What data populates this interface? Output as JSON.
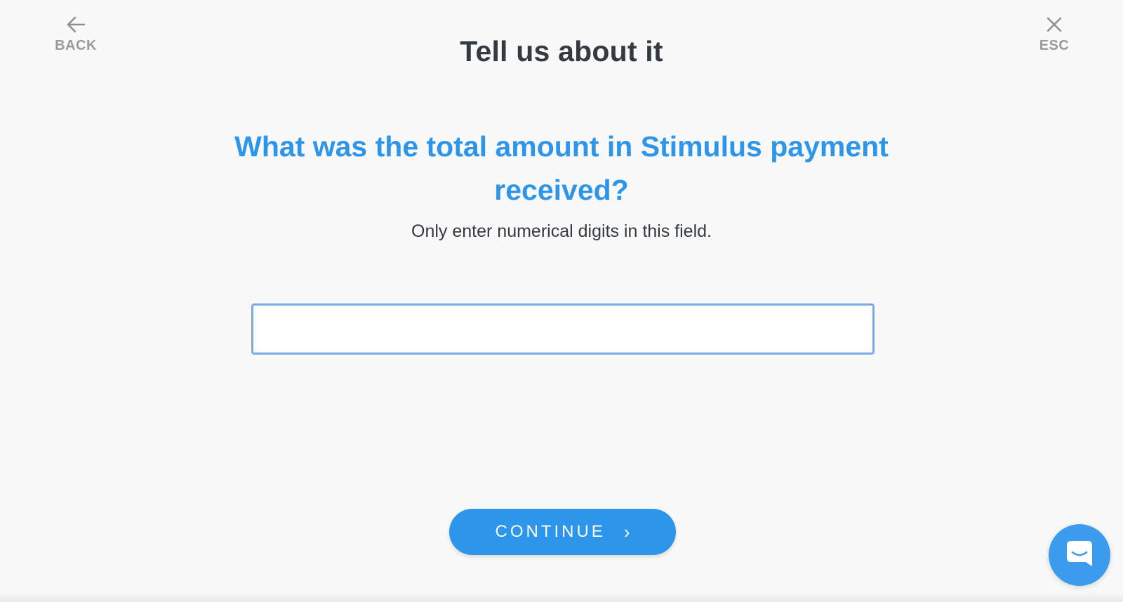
{
  "nav": {
    "back_label": "BACK",
    "esc_label": "ESC"
  },
  "header": {
    "title": "Tell us about it"
  },
  "form": {
    "question": "What was the total amount in Stimulus payment received?",
    "hint": "Only enter numerical digits in this field.",
    "amount_value": "",
    "amount_placeholder": ""
  },
  "actions": {
    "continue_label": "CONTINUE",
    "continue_chevron": "›"
  },
  "icons": {
    "back": "arrow-left-icon",
    "esc": "close-icon",
    "chat": "chat-bubble-icon"
  },
  "colors": {
    "accent": "#2d96ea",
    "title": "#343a40",
    "nav": "#9a9a9a",
    "input_border": "#7fa8e8",
    "background": "#f9f9f9"
  }
}
